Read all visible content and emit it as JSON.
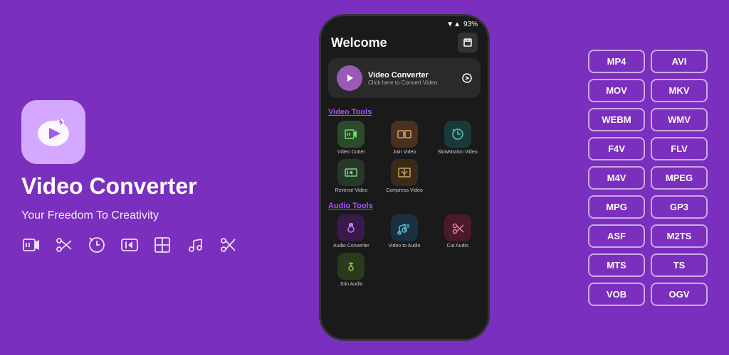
{
  "app": {
    "icon_alt": "video-converter-icon",
    "title": "Video Converter",
    "subtitle": "Your Freedom To Creativity"
  },
  "phone": {
    "status": {
      "signal": "▼▲",
      "battery": "93%"
    },
    "header": {
      "title": "Welcome",
      "icon_label": "history-icon"
    },
    "converter_card": {
      "name": "Video Converter",
      "sub": "Click here to Convert Video"
    },
    "sections": [
      {
        "label": "Video Tools",
        "items": [
          {
            "name": "Video Cutter",
            "bg": "bg-green"
          },
          {
            "name": "Join Video",
            "bg": "bg-brown"
          },
          {
            "name": "SlowMotion Video",
            "bg": "bg-dark-teal"
          },
          {
            "name": "Reverse Video",
            "bg": "bg-dark-green2"
          },
          {
            "name": "Compress Video",
            "bg": "bg-dark-brown2"
          }
        ]
      },
      {
        "label": "Audio Tools",
        "items": [
          {
            "name": "Audio Converter",
            "bg": "bg-purple-dark"
          },
          {
            "name": "Video to Audio",
            "bg": "bg-teal-dark"
          },
          {
            "name": "Cut Audio",
            "bg": "bg-pink-dark"
          },
          {
            "name": "Join Audio",
            "bg": "bg-olive"
          }
        ]
      }
    ]
  },
  "formats": [
    "MP4",
    "AVI",
    "MOV",
    "MKV",
    "WEBM",
    "WMV",
    "F4V",
    "FLV",
    "M4V",
    "MPEG",
    "MPG",
    "GP3",
    "ASF",
    "M2TS",
    "MTS",
    "TS",
    "VOB",
    "OGV"
  ],
  "toolbar_icons": [
    "video-tool-icon",
    "cut-tool-icon",
    "slow-motion-icon",
    "rewind-icon",
    "compress-icon",
    "music-icon",
    "scissors-icon"
  ]
}
